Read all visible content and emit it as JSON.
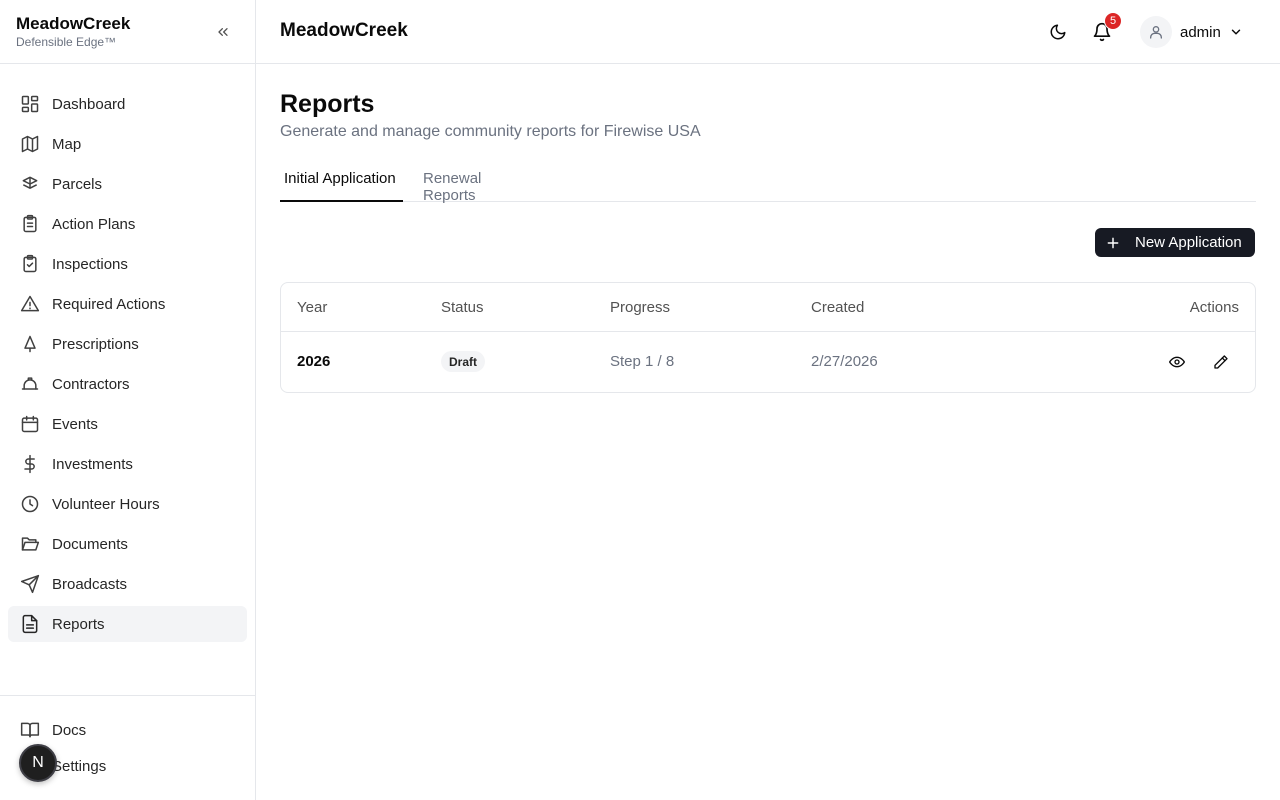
{
  "sidebar": {
    "brand": "MeadowCreek",
    "brand_sub": "Defensible Edge™",
    "items": [
      {
        "label": "Dashboard",
        "icon": "dashboard-icon"
      },
      {
        "label": "Map",
        "icon": "map-icon"
      },
      {
        "label": "Parcels",
        "icon": "parcels-icon"
      },
      {
        "label": "Action Plans",
        "icon": "clipboard-list-icon"
      },
      {
        "label": "Inspections",
        "icon": "clipboard-check-icon"
      },
      {
        "label": "Required Actions",
        "icon": "warning-triangle-icon"
      },
      {
        "label": "Prescriptions",
        "icon": "tree-icon"
      },
      {
        "label": "Contractors",
        "icon": "hard-hat-icon"
      },
      {
        "label": "Events",
        "icon": "calendar-icon"
      },
      {
        "label": "Investments",
        "icon": "dollar-icon"
      },
      {
        "label": "Volunteer Hours",
        "icon": "clock-icon"
      },
      {
        "label": "Documents",
        "icon": "folder-open-icon"
      },
      {
        "label": "Broadcasts",
        "icon": "send-icon"
      },
      {
        "label": "Reports",
        "icon": "file-text-icon",
        "active": true
      }
    ],
    "bottom": [
      {
        "label": "Docs",
        "icon": "book-icon"
      },
      {
        "label": "Settings",
        "icon": "gear-icon"
      }
    ],
    "fab_label": "N"
  },
  "header": {
    "title": "MeadowCreek",
    "notification_count": "5",
    "user": "admin"
  },
  "main": {
    "title": "Reports",
    "subtitle": "Generate and manage community reports for Firewise USA",
    "tabs": [
      {
        "label": "Initial Application",
        "active": true
      },
      {
        "label": "Renewal Reports",
        "active": false
      }
    ],
    "new_button": "New Application",
    "table": {
      "columns": [
        "Year",
        "Status",
        "Progress",
        "Created",
        "Actions"
      ],
      "rows": [
        {
          "year": "2026",
          "status": "Draft",
          "progress": "Step 1 / 8",
          "created": "2/27/2026"
        }
      ]
    }
  }
}
